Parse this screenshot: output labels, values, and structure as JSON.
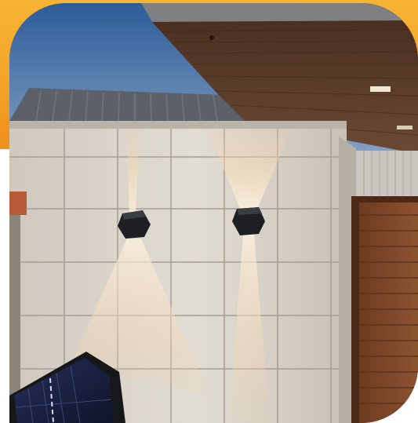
{
  "scene": {
    "subject": "solar-wall-lights",
    "colors": {
      "sunset_top": "#f6b334",
      "sunset_bottom": "#f08f1c",
      "sky_top": "#2f5f9a",
      "sky_bottom": "#7f9ec2",
      "wall_tile": "#dcd6cd",
      "wall_tile_dark": "#cfc8bd",
      "grout": "#a9a297",
      "soffit_wood": "#5b3d2a",
      "door_wood": "#7a4527",
      "fixture": "#1d1f22",
      "light_beam": "#fff2dc",
      "solar_panel": "#1a1f3a"
    }
  }
}
